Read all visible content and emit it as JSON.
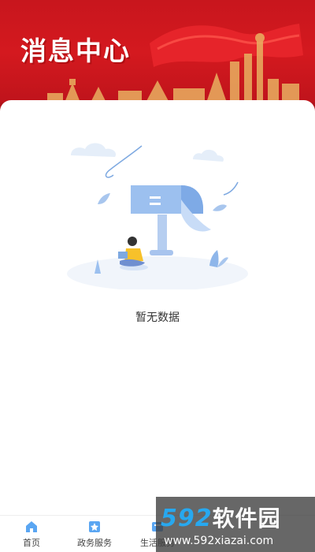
{
  "header": {
    "title": "消息中心"
  },
  "empty_state": {
    "message": "暂无数据"
  },
  "tabbar": {
    "items": [
      {
        "label": "首页",
        "icon": "home-icon"
      },
      {
        "label": "政务服务",
        "icon": "government-service-icon"
      },
      {
        "label": "生活服务",
        "icon": "life-service-icon"
      },
      {
        "label": "",
        "icon": "tab-icon"
      },
      {
        "label": "",
        "icon": "tab-icon"
      }
    ]
  },
  "watermark": {
    "logo_number": "592",
    "logo_text": "软件园",
    "url": "www.592xiazai.com"
  },
  "colors": {
    "banner_red": "#c8161d",
    "accent_blue": "#27a8ef",
    "illustration_blue": "#9cc0ef"
  }
}
